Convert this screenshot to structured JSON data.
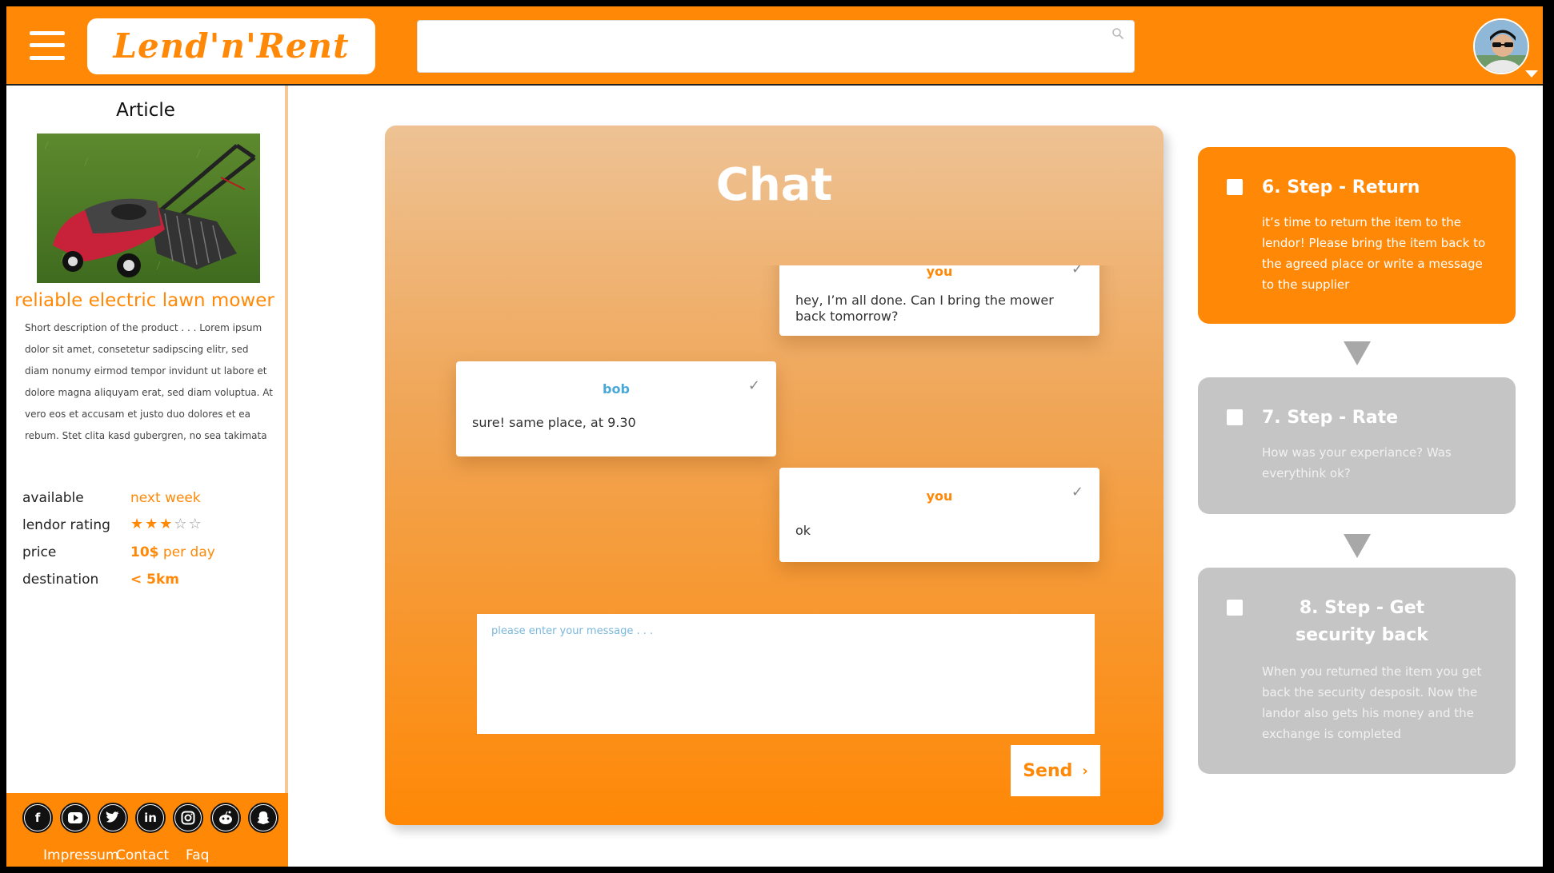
{
  "colors": {
    "brand": "#ff8806",
    "step_inactive": "#c5c5c5",
    "bob_accent": "#4aa8d8"
  },
  "header": {
    "logo": "Lend'n'Rent",
    "search": {
      "value": "",
      "placeholder": ""
    },
    "menu_icon": "hamburger-icon",
    "avatar_icon": "user-avatar"
  },
  "sidebar": {
    "title": "Article",
    "product_name": "reliable electric lawn mower",
    "description": "Short description of the product  . . . Lorem ipsum dolor sit amet, consetetur sadipscing elitr, sed diam nonumy eirmod tempor invidunt ut labore et dolore magna aliquyam erat, sed diam voluptua. At vero eos et accusam et justo duo dolores et ea rebum. Stet clita kasd gubergren, no sea takimata",
    "info": {
      "available_label": "available",
      "available_value": "next week",
      "rating_label": "lendor rating",
      "rating_value": 3,
      "rating_max": 5,
      "price_label": "price",
      "price_amount": "10$",
      "price_unit": "per day",
      "destination_label": "destination",
      "destination_value": "< 5km"
    },
    "social": [
      "facebook-icon",
      "youtube-icon",
      "twitter-icon",
      "linkedin-icon",
      "instagram-icon",
      "reddit-icon",
      "snapchat-icon"
    ],
    "footer_links": [
      "Impressum",
      "Contact",
      "Faq"
    ]
  },
  "chat": {
    "title": "Chat",
    "messages": [
      {
        "sender": "you",
        "text": "hey, I’m all done. Can I bring the mower back tomorrow?"
      },
      {
        "sender": "bob",
        "text": "sure! same place, at 9.30"
      },
      {
        "sender": "you",
        "text": "ok"
      }
    ],
    "input_placeholder": "please enter your message . . .",
    "send_label": "Send"
  },
  "steps": [
    {
      "title": "6. Step - Return",
      "description": "it’s time to return the item to the lendor! Please bring the item back to the agreed place or write a message to the supplier",
      "active": true
    },
    {
      "title": "7. Step - Rate",
      "description": "How was your experiance? Was everythink ok?",
      "active": false
    },
    {
      "title": "8. Step - Get security back",
      "description": "When you returned the item you get back the security desposit. Now the landor also gets his money and the exchange is completed",
      "active": false
    }
  ]
}
